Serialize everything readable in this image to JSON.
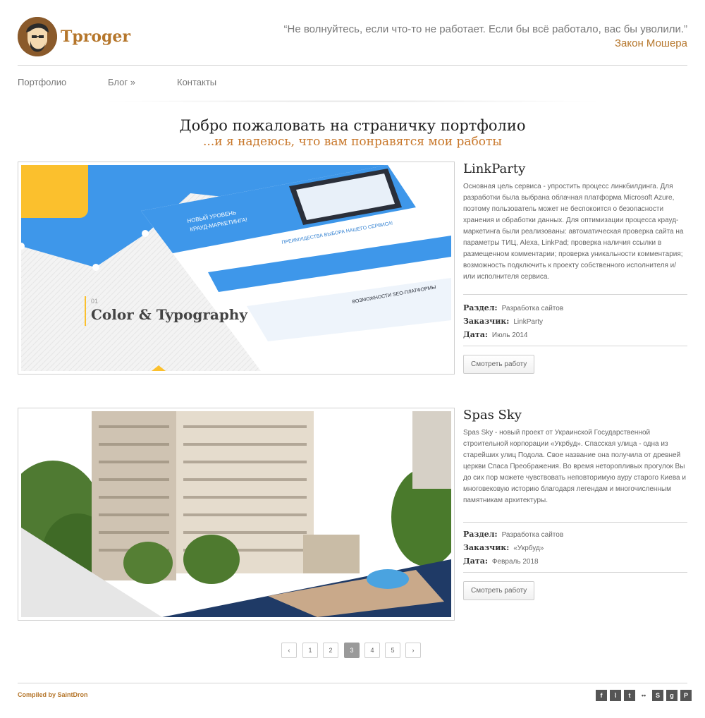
{
  "header": {
    "logo_text": "Tproger",
    "quote": "“Не волнуйтесь, если что-то не работает. Если бы всё работало, вас бы уволили.”",
    "quote_author": "Закон Мошера"
  },
  "nav": {
    "items": [
      {
        "label": "Портфолио"
      },
      {
        "label": "Блог »"
      },
      {
        "label": "Контакты"
      }
    ]
  },
  "welcome": {
    "title": "Добро пожаловать на страничку портфолио",
    "subtitle": "...и я надеюсь, что вам понравятся мои работы"
  },
  "projects": [
    {
      "title": "LinkParty",
      "description": "Основная цель сервиса - упростить процесс линкбилдинга. Для разработки была выбрана облачная платформа Microsoft Azure, поэтому пользователь может не беспокоится о безопасности хранения и обработки данных. Для оптимизации процесса крауд-маркетинга были реализованы: автоматическая проверка сайта на параметры ТИЦ, Alexa, LinkPad; проверка наличия ссылки в размещенном комментарии; проверка уникальности комментария; возможность подключить к проекту собственного исполнителя и/или исполнителя сервиса.",
      "section_label": "Раздел:",
      "section_value": "Разработка сайтов",
      "client_label": "Заказчик:",
      "client_value": "LinkParty",
      "date_label": "Дата:",
      "date_value": "Июль 2014",
      "button": "Смотреть работу",
      "image": {
        "step": "01",
        "caption": "Color & Typography",
        "hero_line1": "НОВЫЙ УРОВЕНЬ",
        "hero_line2": "КРАУД-МАРКЕТИНГА!",
        "band": "ПРЕИМУЩЕСТВА ВЫБОРА НАШЕГО СЕРВИСА!",
        "band2": "ВОЗМОЖНОСТИ SEO-ПЛАТФОРМЫ"
      }
    },
    {
      "title": "Spas Sky",
      "description": "Spas Sky - новый проект от Украинской Государственной строительной корпорации «Укрбуд». Спасская улица - одна из старейших улиц Подола. Свое название она получила от древней церкви Спаса Преображения. Во время неторопливых прогулок Вы до сих пор можете чувствовать неповторимую ауру старого Киева и многовековую историю благодаря легендам и многочисленным памятникам архитектуры.",
      "section_label": "Раздел:",
      "section_value": "Разработка сайтов",
      "client_label": "Заказчик:",
      "client_value": "«Укрбуд»",
      "date_label": "Дата:",
      "date_value": "Февраль 2018",
      "button": "Смотреть работу"
    }
  ],
  "pagination": {
    "prev": "‹",
    "pages": [
      "1",
      "2",
      "3",
      "4",
      "5"
    ],
    "active": "3",
    "next": "›"
  },
  "footer": {
    "credit": "Compiled by SaintDron",
    "social": [
      {
        "icon": "facebook-icon",
        "glyph": "f"
      },
      {
        "icon": "rss-icon",
        "glyph": "⌇"
      },
      {
        "icon": "twitter-icon",
        "glyph": "t"
      },
      {
        "icon": "flickr-icon",
        "glyph": "••"
      },
      {
        "icon": "skype-icon",
        "glyph": "S"
      },
      {
        "icon": "google-plus-icon",
        "glyph": "g"
      },
      {
        "icon": "pinterest-icon",
        "glyph": "P"
      }
    ]
  },
  "colors": {
    "accent": "#b5762b",
    "text": "#555555",
    "heading": "#222222"
  }
}
